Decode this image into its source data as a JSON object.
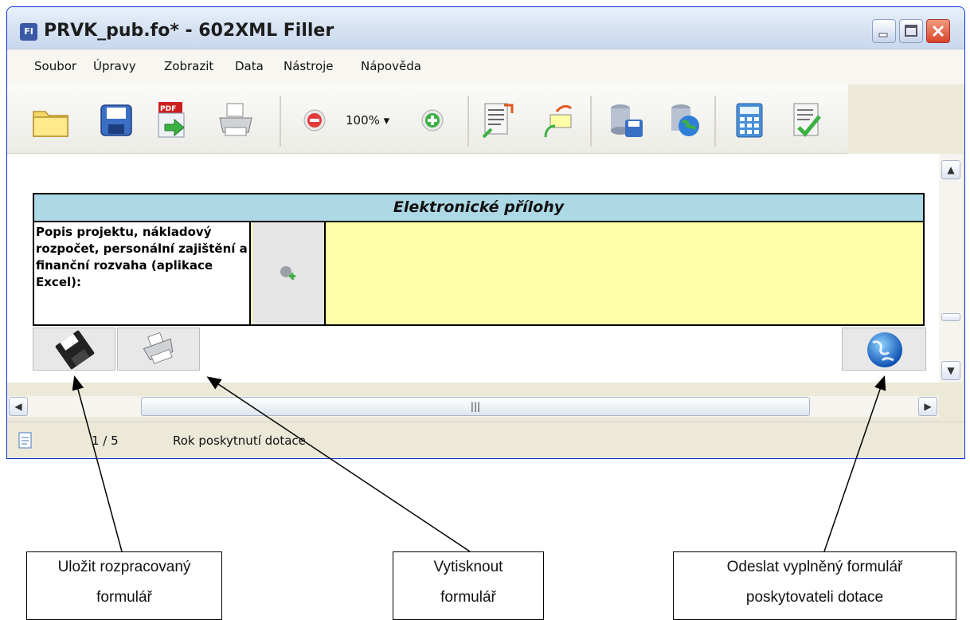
{
  "window": {
    "title": "PRVK_pub.fo* - 602XML Filler",
    "app_icon": "FI"
  },
  "menu": [
    "Soubor",
    "Úpravy",
    "Zobrazit",
    "Data",
    "Nástroje",
    "Nápověda"
  ],
  "toolbar": {
    "zoom": "100% ▾"
  },
  "form": {
    "section_title": "Elektronické přílohy",
    "description": "Popis projektu, nákladový rozpočet, personální zajištění a finanční rozvaha (aplikace Excel):"
  },
  "statusbar": {
    "page": "1 / 5",
    "field": "Rok poskytnutí dotace"
  },
  "callouts": {
    "save": [
      "Uložit rozpracovaný",
      "formulář"
    ],
    "print": [
      "Vytisknout",
      "formulář"
    ],
    "send": [
      "Odeslat vyplněný formulář",
      "poskytovateli dotace"
    ]
  },
  "colors": {
    "section_head": "#add8e6",
    "field_bg": "#ffffa8",
    "title_blue": "#0831d9"
  },
  "icons": [
    "folder-icon",
    "save-icon",
    "pdf-export-icon",
    "print-icon",
    "zoom-out-icon",
    "zoom-in-icon",
    "import-icon",
    "export-icon",
    "database-save-icon",
    "database-globe-icon",
    "calculator-icon",
    "check-document-icon",
    "attach-file-icon",
    "floppy-icon",
    "printer-icon",
    "globe-icon"
  ]
}
